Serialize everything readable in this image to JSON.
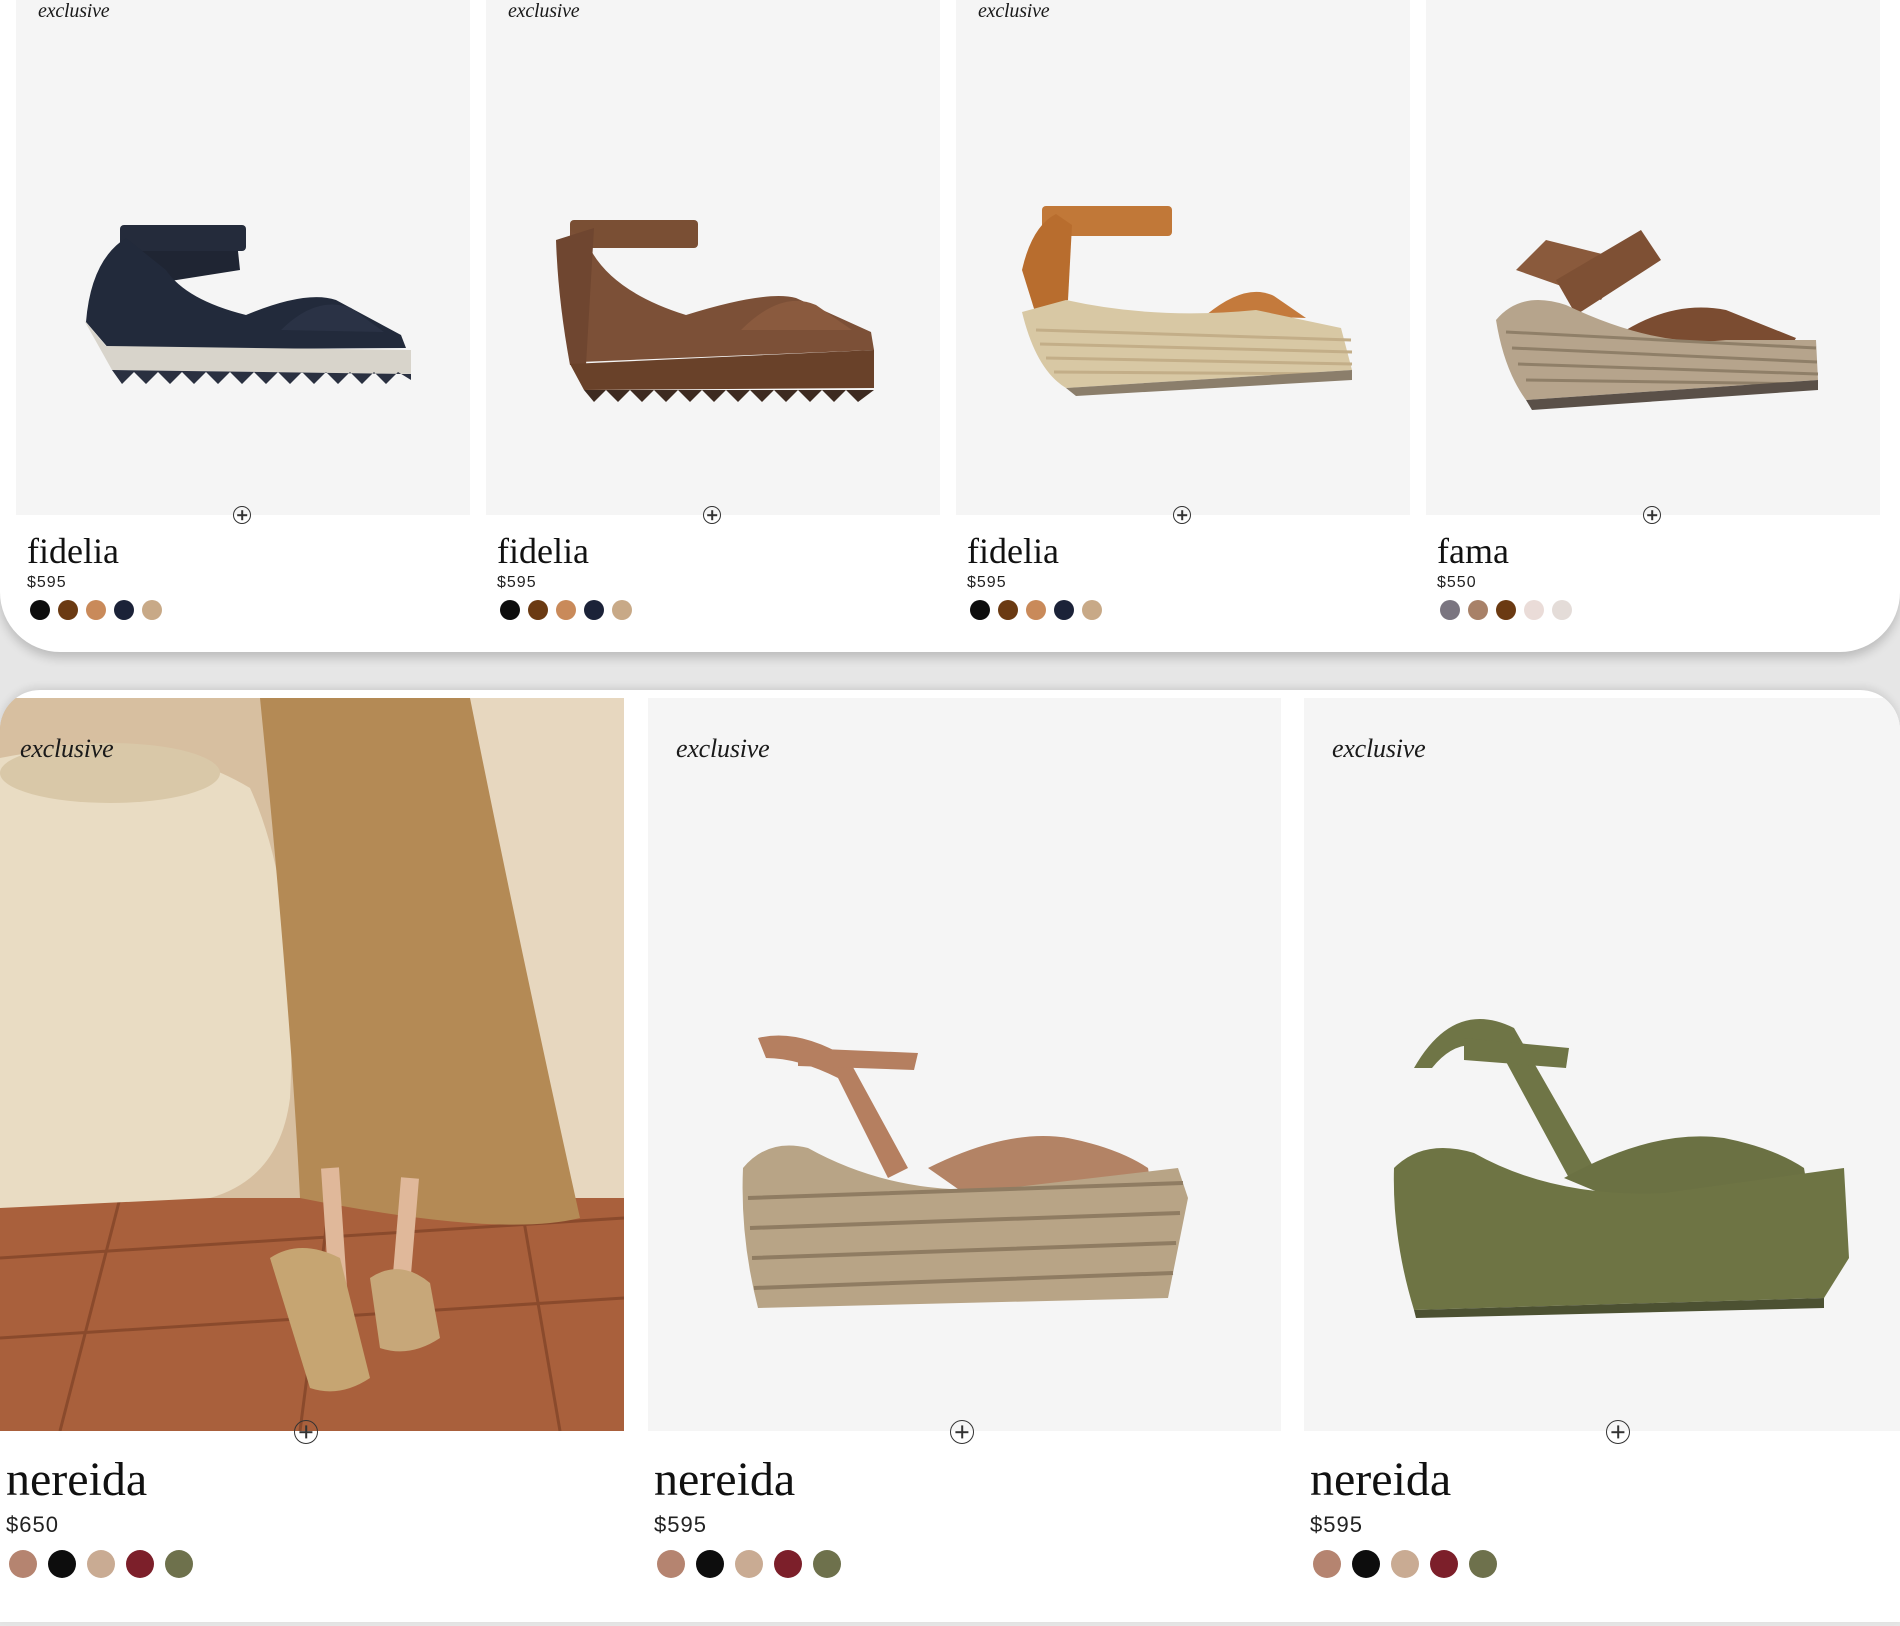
{
  "top_products": [
    {
      "badge": "exclusive",
      "name": "fidelia",
      "price": "$595",
      "swatches": [
        "#0d0d0d",
        "#6b3a12",
        "#c98a5a",
        "#1b2238",
        "#c8a987"
      ]
    },
    {
      "badge": "exclusive",
      "name": "fidelia",
      "price": "$595",
      "swatches": [
        "#0d0d0d",
        "#6b3a12",
        "#c98a5a",
        "#1b2238",
        "#c8a987"
      ]
    },
    {
      "badge": "exclusive",
      "name": "fidelia",
      "price": "$595",
      "swatches": [
        "#0d0d0d",
        "#6b3a12",
        "#c98a5a",
        "#1b2238",
        "#c8a987"
      ]
    },
    {
      "badge": "",
      "name": "fama",
      "price": "$550",
      "swatches": [
        "#7a7580",
        "#a88168",
        "#6b3a12",
        "#eadcd8",
        "#e4dcd8"
      ]
    }
  ],
  "bottom_products": [
    {
      "badge": "exclusive",
      "name": "nereida",
      "price": "$650",
      "swatches": [
        "#b58470",
        "#0d0d0d",
        "#c9ab93",
        "#7c1f2a",
        "#6e714c"
      ]
    },
    {
      "badge": "exclusive",
      "name": "nereida",
      "price": "$595",
      "swatches": [
        "#b58470",
        "#0d0d0d",
        "#c9ab93",
        "#7c1f2a",
        "#6e714c"
      ]
    },
    {
      "badge": "exclusive",
      "name": "nereida",
      "price": "$595",
      "swatches": [
        "#b58470",
        "#0d0d0d",
        "#c9ab93",
        "#7c1f2a",
        "#6e714c"
      ]
    }
  ],
  "icons": {
    "add": "plus-circle-icon"
  }
}
